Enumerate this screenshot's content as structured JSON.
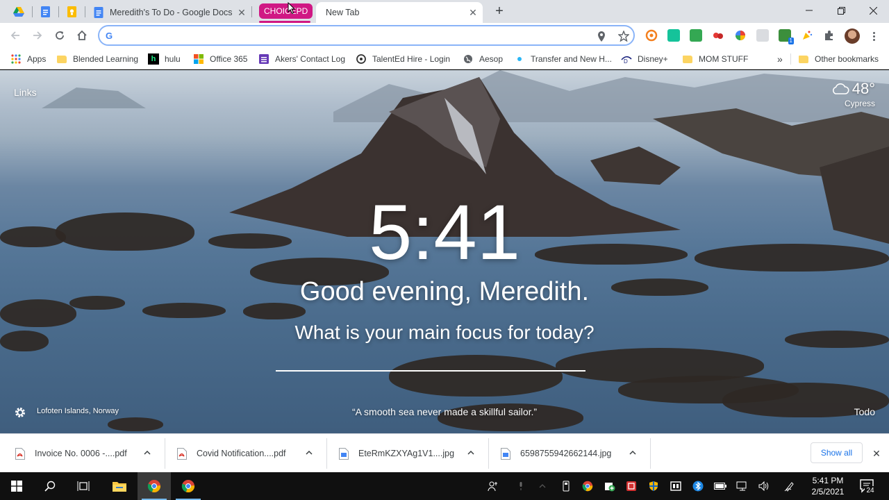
{
  "browser": {
    "pinned_tabs": [
      {
        "icon": "google-drive-icon"
      },
      {
        "icon": "google-docs-icon"
      },
      {
        "icon": "google-keep-icon"
      }
    ],
    "tabs": [
      {
        "title": "Meredith's To Do - Google Docs",
        "icon": "google-docs-icon"
      },
      {
        "title": "New Tab",
        "icon": ""
      }
    ],
    "tab_group": {
      "label": "CHOICEPD",
      "color": "#d01884"
    },
    "omnibox": {
      "value": "",
      "placeholder": ""
    },
    "bookmarks": [
      {
        "label": "Apps",
        "icon": "apps-grid-icon"
      },
      {
        "label": "Blended Learning",
        "icon": "folder-icon"
      },
      {
        "label": "hulu",
        "icon": "hulu-icon"
      },
      {
        "label": "Office 365",
        "icon": "office-icon"
      },
      {
        "label": "Akers' Contact Log",
        "icon": "form-icon"
      },
      {
        "label": "TalentEd Hire  - Login",
        "icon": "talented-icon"
      },
      {
        "label": "Aesop",
        "icon": "aesop-icon"
      },
      {
        "label": "Transfer and New H...",
        "icon": "dot-icon"
      },
      {
        "label": "Disney+",
        "icon": "disney-icon"
      },
      {
        "label": "MOM STUFF",
        "icon": "folder-icon"
      }
    ],
    "bookmarks_overflow": "»",
    "other_bookmarks": "Other bookmarks"
  },
  "momentum": {
    "links": "Links",
    "weather": {
      "temp": "48°",
      "location": "Cypress"
    },
    "time": "5:41",
    "greeting": "Good evening, Meredith.",
    "focus_prompt": "What is your main focus for today?",
    "photo_location": "Lofoten Islands, Norway",
    "quote": "“A smooth sea never made a skillful sailor.”",
    "todo": "Todo"
  },
  "downloads": {
    "items": [
      {
        "name": "Invoice No. 0006 -....pdf",
        "type": "pdf"
      },
      {
        "name": "Covid Notification....pdf",
        "type": "pdf"
      },
      {
        "name": "EteRmKZXYAg1V1....jpg",
        "type": "jpg"
      },
      {
        "name": "6598755942662144.jpg",
        "type": "jpg"
      }
    ],
    "show_all": "Show all"
  },
  "taskbar": {
    "time": "5:41 PM",
    "date": "2/5/2021",
    "notification_count": "24"
  }
}
